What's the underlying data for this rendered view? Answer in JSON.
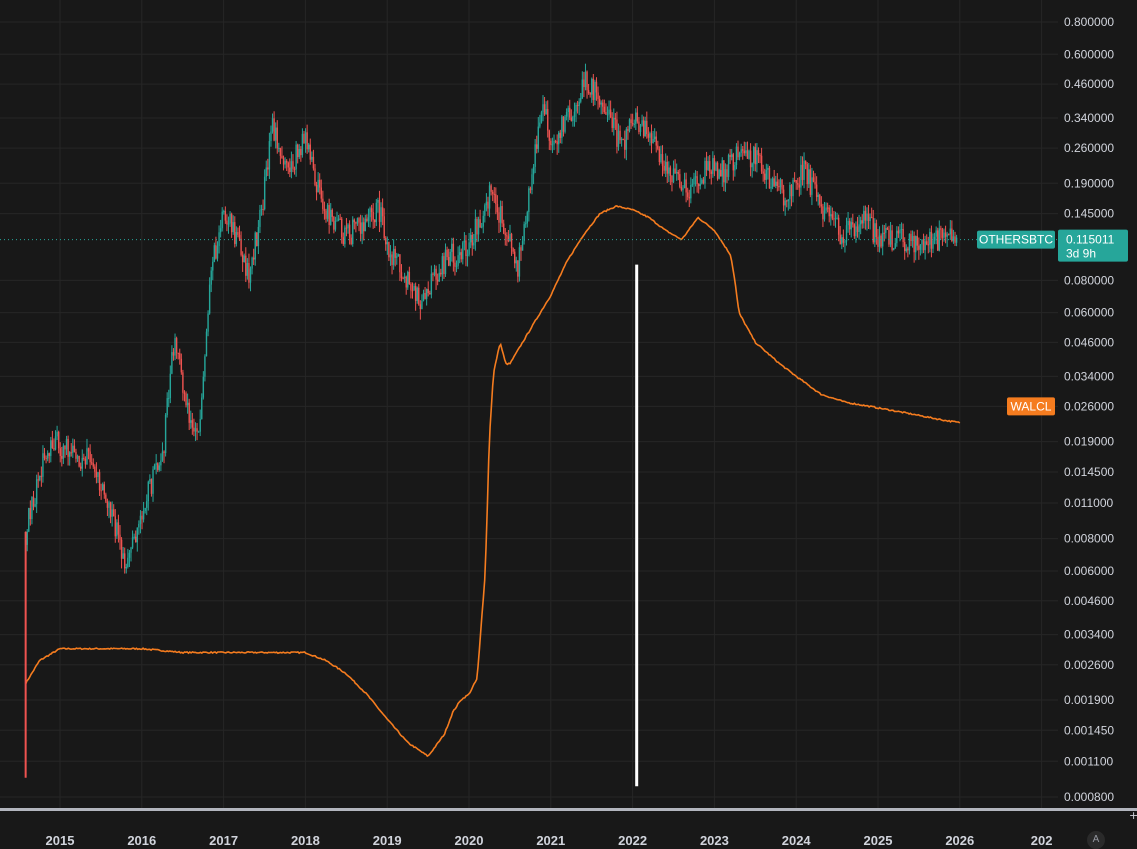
{
  "chart_data": {
    "type": "line",
    "scale": "log",
    "grid": true,
    "colors": {
      "background": "#181818",
      "grid": "#262626",
      "up": "#26a69a",
      "down": "#ef5350",
      "walcl": "#f57c1f",
      "marker": "#ffffff",
      "axis_line": "#b2b5be"
    },
    "y_ticks": [
      "0.800000",
      "0.600000",
      "0.460000",
      "0.340000",
      "0.260000",
      "0.190000",
      "0.145000",
      "0.080000",
      "0.060000",
      "0.046000",
      "0.034000",
      "0.026000",
      "0.019000",
      "0.014500",
      "0.011000",
      "0.008000",
      "0.006000",
      "0.004600",
      "0.003400",
      "0.002600",
      "0.001900",
      "0.001450",
      "0.001100",
      "0.000800"
    ],
    "x_ticks": [
      "2015",
      "2016",
      "2017",
      "2018",
      "2019",
      "2020",
      "2021",
      "2022",
      "2023",
      "2024",
      "2025",
      "2026",
      "202"
    ],
    "series": [
      {
        "name": "OTHERSBTC",
        "style": "candles",
        "last_value": "0.115011",
        "countdown": "3d 9h",
        "x": [
          2014.58,
          2014.75,
          2014.9,
          2015.0,
          2015.2,
          2015.4,
          2015.6,
          2015.8,
          2016.0,
          2016.1,
          2016.25,
          2016.4,
          2016.55,
          2016.7,
          2016.85,
          2017.0,
          2017.15,
          2017.3,
          2017.45,
          2017.6,
          2017.8,
          2018.0,
          2018.1,
          2018.3,
          2018.5,
          2018.7,
          2018.9,
          2019.0,
          2019.2,
          2019.4,
          2019.6,
          2019.75,
          2019.9,
          2020.1,
          2020.25,
          2020.45,
          2020.6,
          2020.75,
          2020.9,
          2021.0,
          2021.15,
          2021.25,
          2021.4,
          2021.55,
          2021.7,
          2021.85,
          2022.0,
          2022.15,
          2022.3,
          2022.5,
          2022.7,
          2022.9,
          2023.1,
          2023.3,
          2023.5,
          2023.7,
          2023.9,
          2024.1,
          2024.3,
          2024.45,
          2024.6,
          2024.8,
          2025.0,
          2025.15,
          2025.3,
          2025.5,
          2025.65,
          2025.8,
          2025.9,
          2026.0
        ],
        "values": [
          0.0085,
          0.014,
          0.02,
          0.018,
          0.017,
          0.016,
          0.0105,
          0.0065,
          0.0095,
          0.013,
          0.016,
          0.05,
          0.025,
          0.019,
          0.09,
          0.15,
          0.12,
          0.085,
          0.14,
          0.31,
          0.21,
          0.3,
          0.2,
          0.14,
          0.12,
          0.13,
          0.15,
          0.11,
          0.085,
          0.068,
          0.085,
          0.1,
          0.1,
          0.13,
          0.175,
          0.13,
          0.09,
          0.2,
          0.38,
          0.28,
          0.32,
          0.35,
          0.48,
          0.42,
          0.38,
          0.26,
          0.33,
          0.3,
          0.26,
          0.2,
          0.18,
          0.22,
          0.21,
          0.25,
          0.24,
          0.19,
          0.17,
          0.22,
          0.15,
          0.13,
          0.12,
          0.14,
          0.12,
          0.115,
          0.115,
          0.115,
          0.115,
          0.115,
          0.115,
          0.115
        ]
      },
      {
        "name": "WALCL",
        "style": "line",
        "x": [
          2014.58,
          2014.75,
          2015.0,
          2015.5,
          2016.0,
          2016.5,
          2017.0,
          2017.5,
          2018.0,
          2018.25,
          2018.5,
          2018.75,
          2019.0,
          2019.25,
          2019.5,
          2019.7,
          2019.8,
          2019.9,
          2020.0,
          2020.1,
          2020.2,
          2020.25,
          2020.3,
          2020.38,
          2020.45,
          2020.5,
          2020.6,
          2020.8,
          2021.0,
          2021.2,
          2021.4,
          2021.6,
          2021.8,
          2022.0,
          2022.2,
          2022.4,
          2022.6,
          2022.8,
          2023.0,
          2023.2,
          2023.25,
          2023.3,
          2023.5,
          2023.8,
          2024.0,
          2024.3,
          2024.6,
          2024.9,
          2025.2,
          2025.5,
          2025.8,
          2026.0
        ],
        "values": [
          0.0022,
          0.0027,
          0.003,
          0.003,
          0.003,
          0.0029,
          0.0029,
          0.0029,
          0.0029,
          0.0027,
          0.0024,
          0.002,
          0.0016,
          0.0013,
          0.00115,
          0.0014,
          0.0017,
          0.0019,
          0.002,
          0.0023,
          0.006,
          0.02,
          0.035,
          0.046,
          0.038,
          0.038,
          0.043,
          0.055,
          0.07,
          0.095,
          0.12,
          0.145,
          0.155,
          0.15,
          0.14,
          0.125,
          0.115,
          0.14,
          0.125,
          0.1,
          0.08,
          0.06,
          0.046,
          0.038,
          0.034,
          0.029,
          0.027,
          0.026,
          0.025,
          0.024,
          0.023,
          0.0225
        ]
      }
    ],
    "annotations": {
      "vertical_marker_x": 2022.05,
      "series_tags": [
        "OTHERSBTC",
        "WALCL"
      ]
    }
  },
  "ui": {
    "auto_scale_label": "A",
    "corner_glyph": "+"
  }
}
